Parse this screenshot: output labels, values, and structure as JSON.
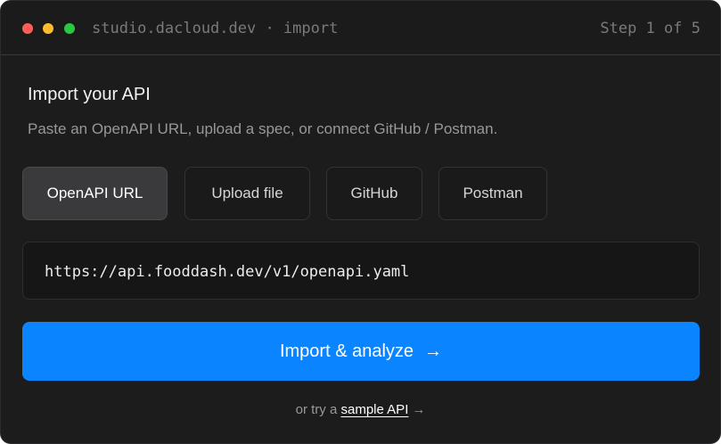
{
  "window": {
    "title": "studio.dacloud.dev · import",
    "step": "Step 1 of 5"
  },
  "main": {
    "heading": "Import your API",
    "subheading": "Paste an OpenAPI URL, upload a spec, or connect GitHub / Postman.",
    "tabs": [
      {
        "label": "OpenAPI URL",
        "selected": true
      },
      {
        "label": "Upload file",
        "selected": false
      },
      {
        "label": "GitHub",
        "selected": false
      },
      {
        "label": "Postman",
        "selected": false
      }
    ],
    "url_input": {
      "value": "https://api.fooddash.dev/v1/openapi.yaml",
      "placeholder": ""
    },
    "primary_button": {
      "label": "Import & analyze",
      "icon": "arrow-right-icon",
      "color": "#0a84ff"
    },
    "footer": {
      "prefix": "or try a",
      "link_label": "sample API",
      "suffix": "→"
    }
  },
  "colors": {
    "window_bg": "#1c1c1d",
    "traffic_close": "#ff5f57",
    "traffic_minimize": "#febc2e",
    "traffic_zoom": "#28c840"
  }
}
